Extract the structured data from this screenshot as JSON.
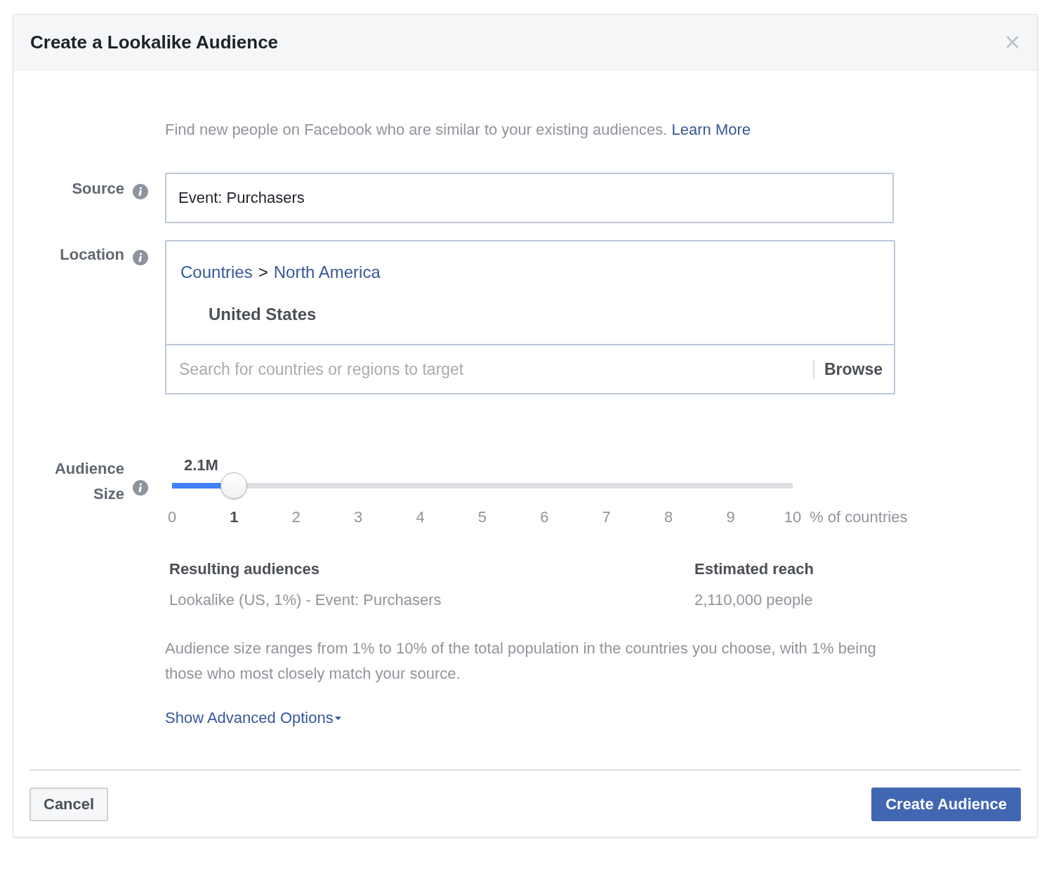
{
  "dialog": {
    "title": "Create a Lookalike Audience",
    "close": "×"
  },
  "intro": {
    "text": "Find new people on Facebook who are similar to your existing audiences.",
    "link": "Learn More"
  },
  "source": {
    "label": "Source",
    "value": "Event: Purchasers"
  },
  "location": {
    "label": "Location",
    "breadcrumb": [
      "Countries",
      "North America"
    ],
    "separator": ">",
    "selected": [
      "United States"
    ],
    "search": {
      "placeholder": "Search for countries or regions to target"
    },
    "browse": "Browse"
  },
  "audience_size": {
    "label": "Audience Size",
    "reading": "2.1M",
    "level": 0.1,
    "unit": "% of countries",
    "ticks": [
      {
        "label": "0",
        "selected": false
      },
      {
        "label": "1",
        "selected": true
      },
      {
        "label": "2",
        "selected": false
      },
      {
        "label": "3",
        "selected": false
      },
      {
        "label": "4",
        "selected": false
      },
      {
        "label": "5",
        "selected": false
      },
      {
        "label": "6",
        "selected": false
      },
      {
        "label": "7",
        "selected": false
      },
      {
        "label": "8",
        "selected": false
      },
      {
        "label": "9",
        "selected": false
      },
      {
        "label": "10",
        "selected": false
      }
    ]
  },
  "results": [
    {
      "heading": "Resulting audiences",
      "value": "Lookalike (US, 1%) - Event: Purchasers"
    },
    {
      "heading": "Estimated reach",
      "value": "2,110,000 people"
    }
  ],
  "note": "Audience size ranges from 1% to 10% of the total population in the countries you choose, with 1% being those who most closely match your source.",
  "advanced_link": "Show Advanced Options",
  "buttons": [
    {
      "label": "Cancel",
      "kind": "secondary"
    },
    {
      "label": "Create Audience",
      "kind": "primary"
    }
  ]
}
